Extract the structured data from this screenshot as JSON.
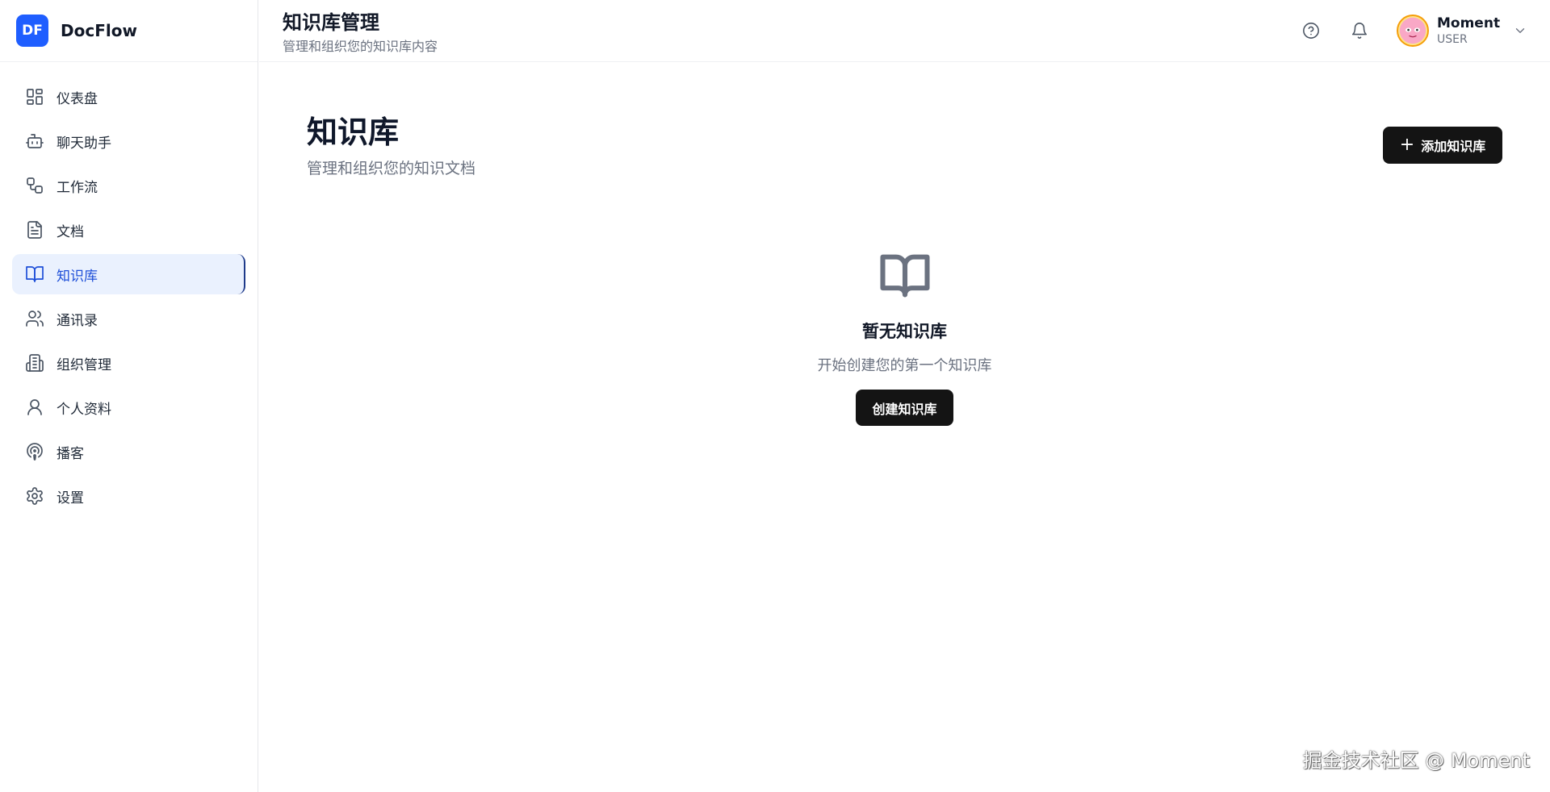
{
  "brand": {
    "logo": "DF",
    "name": "DocFlow",
    "logo_color": "#1f5eff"
  },
  "sidebar": {
    "items": [
      {
        "label": "仪表盘",
        "icon": "dashboard-icon"
      },
      {
        "label": "聊天助手",
        "icon": "bot-icon"
      },
      {
        "label": "工作流",
        "icon": "workflow-icon"
      },
      {
        "label": "文档",
        "icon": "document-icon"
      },
      {
        "label": "知识库",
        "icon": "book-icon",
        "active": true
      },
      {
        "label": "通讯录",
        "icon": "users-icon"
      },
      {
        "label": "组织管理",
        "icon": "building-icon"
      },
      {
        "label": "个人资料",
        "icon": "user-icon"
      },
      {
        "label": "播客",
        "icon": "podcast-icon"
      },
      {
        "label": "设置",
        "icon": "gear-icon"
      }
    ]
  },
  "header": {
    "title": "知识库管理",
    "subtitle": "管理和组织您的知识库内容",
    "user": {
      "name": "Moment",
      "role": "USER"
    }
  },
  "main": {
    "title": "知识库",
    "subtitle": "管理和组织您的知识文档",
    "add_button": "添加知识库",
    "empty": {
      "title": "暂无知识库",
      "subtitle": "开始创建您的第一个知识库",
      "button": "创建知识库"
    }
  },
  "watermark": "掘金技术社区 @ Moment",
  "colors": {
    "accent": "#1d4ed8",
    "active_bg": "#eaf1fe",
    "button_bg": "#141414"
  }
}
